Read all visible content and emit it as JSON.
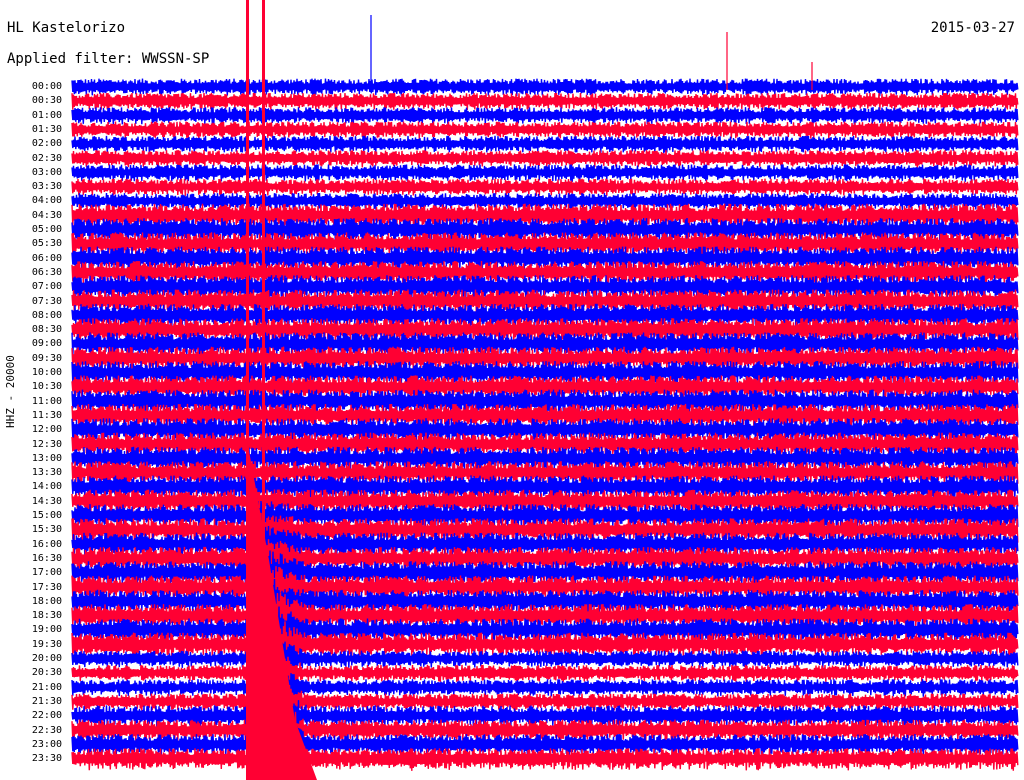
{
  "header": {
    "station": "HL Kastelorizo",
    "date": "2015-03-27",
    "filter": "Applied filter: WWSSN-SP"
  },
  "ylabel": "HHZ - 20000",
  "colors": {
    "trace_a": "#0000ff",
    "trace_b": "#ff0033",
    "background": "#ffffff"
  },
  "chart_data": {
    "type": "line",
    "title": "HL Kastelorizo",
    "channel": "HHZ - 20000",
    "row_labels": [
      "00:00",
      "00:30",
      "01:00",
      "01:30",
      "02:00",
      "02:30",
      "03:00",
      "03:30",
      "04:00",
      "04:30",
      "05:00",
      "05:30",
      "06:00",
      "06:30",
      "07:00",
      "07:30",
      "08:00",
      "08:30",
      "09:00",
      "09:30",
      "10:00",
      "10:30",
      "11:00",
      "11:30",
      "12:00",
      "12:30",
      "13:00",
      "13:30",
      "14:00",
      "14:30",
      "15:00",
      "15:30",
      "16:00",
      "16:30",
      "17:00",
      "17:30",
      "18:00",
      "18:30",
      "19:00",
      "19:30",
      "20:00",
      "20:30",
      "21:00",
      "21:30",
      "22:00",
      "22:30",
      "23:00",
      "23:30"
    ],
    "series": [
      {
        "name": "",
        "color": "#0000ff",
        "rows": "even"
      },
      {
        "name": "",
        "color": "#ff0033",
        "rows": "odd"
      }
    ],
    "events": [
      {
        "minute": 5.5,
        "note": "large event, saturating amplitude"
      },
      {
        "minute": 6.0,
        "note": "second large arrival"
      }
    ]
  }
}
